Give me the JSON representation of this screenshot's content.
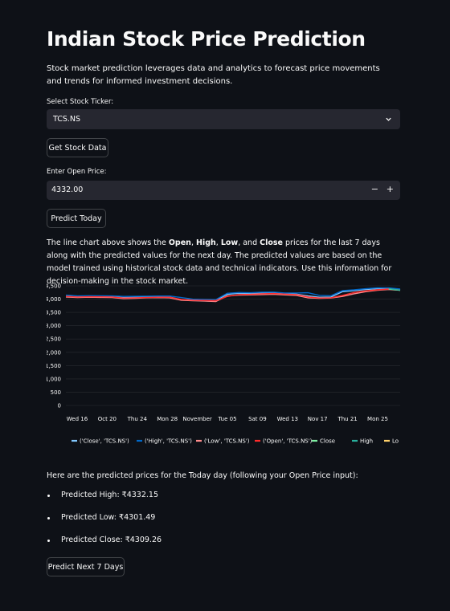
{
  "page": {
    "title": "Indian Stock Price Prediction",
    "intro": "Stock market prediction leverages data and analytics to forecast price movements and trends for informed investment decisions."
  },
  "ticker": {
    "label": "Select Stock Ticker:",
    "value": "TCS.NS"
  },
  "get_data_button": "Get Stock Data",
  "open_price": {
    "label": "Enter Open Price:",
    "value": "4332.00",
    "minus": "−",
    "plus": "+"
  },
  "predict_today_button": "Predict Today",
  "description": {
    "p1": "The line chart above shows the ",
    "open": "Open",
    "c1": ", ",
    "high": "High",
    "c2": ", ",
    "low": "Low",
    "c3": ", and ",
    "close": "Close",
    "p2": " prices for the last 7 days along with the predicted values for the next day. The predicted values are based on the model trained using historical stock data and technical indicators. Use this information for decision-making in the stock market."
  },
  "chart_data": {
    "type": "line",
    "ylim": [
      0,
      4500
    ],
    "y_ticks": [
      "0",
      "500",
      "1,000",
      "1,500",
      "2,000",
      "2,500",
      "3,000",
      "3,500",
      "4,000",
      "4,500"
    ],
    "x_ticks": [
      "Wed 16",
      "Oct 20",
      "Thu 24",
      "Mon 28",
      "November",
      "Tue 05",
      "Sat 09",
      "Wed 13",
      "Nov 17",
      "Thu 21",
      "Mon 25"
    ],
    "grid": true,
    "legend_position": "bottom",
    "series": [
      {
        "name": "('Close', 'TCS.NS')",
        "color": "#83c9ff",
        "values": [
          4110,
          4090,
          4100,
          4095,
          4090,
          4060,
          4070,
          4080,
          4085,
          4080,
          3980,
          3970,
          3960,
          3950,
          4180,
          4220,
          4210,
          4230,
          4240,
          4200,
          4190,
          4120,
          4070,
          4080,
          4280,
          4320,
          4360,
          4390,
          4400,
          4350
        ]
      },
      {
        "name": "('High', 'TCS.NS')",
        "color": "#0068c9",
        "values": [
          4150,
          4120,
          4130,
          4125,
          4120,
          4100,
          4105,
          4110,
          4115,
          4115,
          4060,
          4000,
          3990,
          3980,
          4220,
          4250,
          4240,
          4260,
          4265,
          4230,
          4230,
          4240,
          4140,
          4130,
          4320,
          4350,
          4390,
          4420,
          4420,
          4380
        ]
      },
      {
        "name": "('Low', 'TCS.NS')",
        "color": "#ff8c8c",
        "values": [
          4080,
          4060,
          4070,
          4065,
          4060,
          4020,
          4030,
          4050,
          4055,
          4050,
          3960,
          3940,
          3930,
          3910,
          4120,
          4150,
          4160,
          4170,
          4180,
          4160,
          4140,
          4050,
          4030,
          4040,
          4100,
          4200,
          4280,
          4330,
          4360,
          4330
        ]
      },
      {
        "name": "('Open', 'TCS.NS')",
        "color": "#ff2b2b",
        "values": [
          4100,
          4080,
          4090,
          4085,
          4080,
          4040,
          4050,
          4060,
          4070,
          4070,
          3990,
          3960,
          3950,
          3940,
          4100,
          4170,
          4180,
          4200,
          4210,
          4190,
          4170,
          4080,
          4040,
          4050,
          4140,
          4250,
          4310,
          4350,
          4380,
          4340
        ]
      },
      {
        "name": "Close",
        "color": "#7defa1",
        "values": [
          null,
          null,
          null,
          null,
          null,
          null,
          null,
          null,
          null,
          null,
          null,
          null,
          null,
          null,
          null,
          null,
          null,
          null,
          null,
          null,
          null,
          null,
          null,
          null,
          null,
          null,
          null,
          null,
          4380,
          4330
        ]
      },
      {
        "name": "High",
        "color": "#29b09d",
        "values": [
          null,
          null,
          null,
          null,
          null,
          null,
          null,
          null,
          null,
          null,
          null,
          null,
          null,
          null,
          null,
          null,
          null,
          null,
          null,
          null,
          null,
          null,
          null,
          null,
          null,
          null,
          null,
          null,
          4390,
          4340
        ]
      },
      {
        "name": "Lo",
        "color": "#ffd16a",
        "values": []
      }
    ]
  },
  "predictions": {
    "intro": "Here are the predicted prices for the Today day (following your Open Price input):",
    "high": "Predicted High: ₹4332.15",
    "low": "Predicted Low: ₹4301.49",
    "close": "Predicted Close: ₹4309.26"
  },
  "predict_7_button": "Predict Next 7 Days",
  "colors": {
    "background": "#0e1117",
    "input_bg": "#262730",
    "text": "#fafafa"
  },
  "icons": {
    "select": "chevron-down-icon"
  }
}
